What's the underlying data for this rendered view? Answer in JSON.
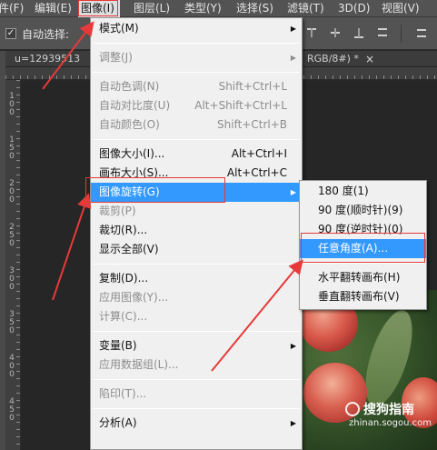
{
  "menubar": {
    "items": [
      "件(F)",
      "编辑(E)",
      "图像(I)",
      "图层(L)",
      "类型(Y)",
      "选择(S)",
      "滤镜(T)",
      "3D(D)",
      "视图(V)"
    ]
  },
  "options_bar": {
    "auto_select_label": "自动选择:",
    "auto_select_checked": "✓"
  },
  "document": {
    "tab_title": "u=12939513",
    "tab_title_right": "RGB/8#) *",
    "close_glyph": "×"
  },
  "rulers": {
    "left_labels": [
      "1\n0\n0",
      "1\n5\n0",
      "2\n0\n0",
      "2\n5\n0",
      "3\n0\n0",
      "3\n5\n0",
      "4\n0\n0",
      "4\n5\n0"
    ]
  },
  "image_menu": {
    "items": [
      {
        "label": "模式(M)",
        "shortcut": "",
        "submenu": true,
        "disabled": false
      },
      {
        "label": "调整(J)",
        "shortcut": "",
        "submenu": true,
        "disabled": true
      },
      {
        "label": "自动色调(N)",
        "shortcut": "Shift+Ctrl+L",
        "submenu": false,
        "disabled": true
      },
      {
        "label": "自动对比度(U)",
        "shortcut": "Alt+Shift+Ctrl+L",
        "submenu": false,
        "disabled": true
      },
      {
        "label": "自动颜色(O)",
        "shortcut": "Shift+Ctrl+B",
        "submenu": false,
        "disabled": true
      },
      {
        "label": "图像大小(I)...",
        "shortcut": "Alt+Ctrl+I",
        "submenu": false,
        "disabled": false
      },
      {
        "label": "画布大小(S)...",
        "shortcut": "Alt+Ctrl+C",
        "submenu": false,
        "disabled": false
      },
      {
        "label": "图像旋转(G)",
        "shortcut": "",
        "submenu": true,
        "disabled": false,
        "highlighted": true
      },
      {
        "label": "裁剪(P)",
        "shortcut": "",
        "submenu": false,
        "disabled": true
      },
      {
        "label": "裁切(R)...",
        "shortcut": "",
        "submenu": false,
        "disabled": false
      },
      {
        "label": "显示全部(V)",
        "shortcut": "",
        "submenu": false,
        "disabled": false
      },
      {
        "label": "复制(D)...",
        "shortcut": "",
        "submenu": false,
        "disabled": false
      },
      {
        "label": "应用图像(Y)...",
        "shortcut": "",
        "submenu": false,
        "disabled": true
      },
      {
        "label": "计算(C)...",
        "shortcut": "",
        "submenu": false,
        "disabled": true
      },
      {
        "label": "变量(B)",
        "shortcut": "",
        "submenu": true,
        "disabled": false
      },
      {
        "label": "应用数据组(L)...",
        "shortcut": "",
        "submenu": false,
        "disabled": true
      },
      {
        "label": "陷印(T)...",
        "shortcut": "",
        "submenu": false,
        "disabled": true
      },
      {
        "label": "分析(A)",
        "shortcut": "",
        "submenu": true,
        "disabled": false
      }
    ]
  },
  "rotation_submenu": {
    "items": [
      {
        "label": "180 度(1)"
      },
      {
        "label": "90 度(顺时针)(9)"
      },
      {
        "label": "90 度(逆时针)(0)"
      },
      {
        "label": "任意角度(A)...",
        "highlighted": true
      },
      {
        "label": "水平翻转画布(H)"
      },
      {
        "label": "垂直翻转画布(V)"
      }
    ]
  },
  "watermark": {
    "name": "搜狗指南",
    "url": "zhinan.sogou.com"
  },
  "glyphs": {
    "submenu_arrow": "▶"
  },
  "colors": {
    "highlight": "#3399ff",
    "annotation": "#e53a3a",
    "menu_bg": "#f0f0f0",
    "app_bg": "#535353"
  }
}
